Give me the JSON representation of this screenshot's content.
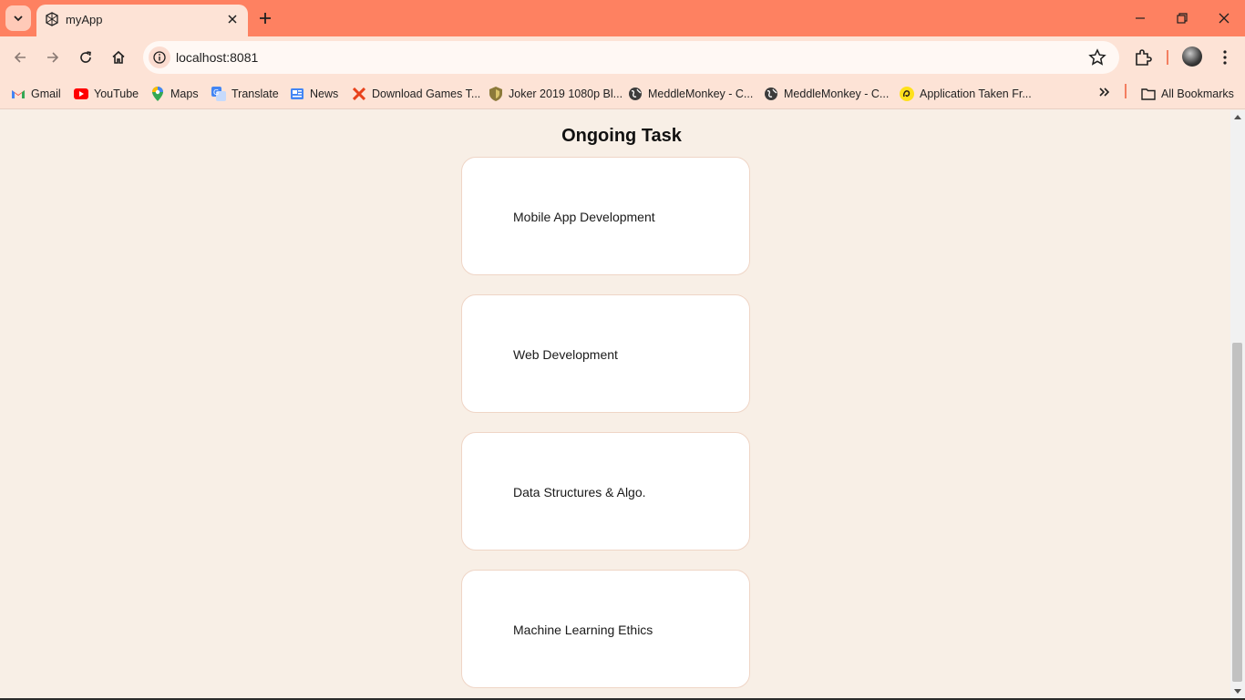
{
  "browser": {
    "tab_title": "myApp",
    "url": "localhost:8081",
    "accent_color": "#fe8161",
    "bookmarks": [
      {
        "label": "Gmail",
        "icon": "gmail-icon"
      },
      {
        "label": "YouTube",
        "icon": "youtube-icon"
      },
      {
        "label": "Maps",
        "icon": "maps-icon"
      },
      {
        "label": "Translate",
        "icon": "translate-icon"
      },
      {
        "label": "News",
        "icon": "news-icon"
      },
      {
        "label": "Download Games T...",
        "icon": "x-icon"
      },
      {
        "label": "Joker 2019 1080p Bl...",
        "icon": "shield-icon"
      },
      {
        "label": "MeddleMonkey - C...",
        "icon": "globe-icon"
      },
      {
        "label": "MeddleMonkey - C...",
        "icon": "globe-icon"
      },
      {
        "label": "Application Taken Fr...",
        "icon": "mailchimp-icon"
      }
    ],
    "all_bookmarks_label": "All Bookmarks"
  },
  "page": {
    "title": "Ongoing Task",
    "tasks": [
      {
        "label": "Mobile App Development"
      },
      {
        "label": "Web Development"
      },
      {
        "label": "Data Structures & Algo."
      },
      {
        "label": "Machine Learning Ethics"
      }
    ]
  }
}
